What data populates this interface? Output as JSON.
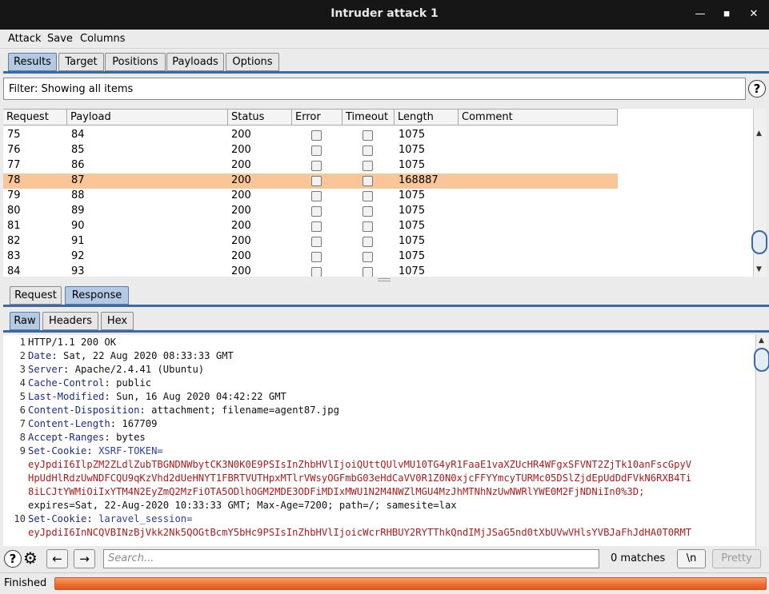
{
  "window": {
    "title": "Intruder attack 1",
    "minimize": "—",
    "maximize": "◼",
    "close": "✕"
  },
  "menu": [
    "Attack",
    "Save",
    "Columns"
  ],
  "main_tabs": [
    {
      "label": "Results",
      "active": true
    },
    {
      "label": "Target",
      "active": false
    },
    {
      "label": "Positions",
      "active": false
    },
    {
      "label": "Payloads",
      "active": false
    },
    {
      "label": "Options",
      "active": false
    }
  ],
  "filter": {
    "text": "Filter: Showing all items",
    "help": "?"
  },
  "table": {
    "columns": [
      "Request",
      "Payload",
      "Status",
      "Error",
      "Timeout",
      "Length",
      "Comment"
    ],
    "rows": [
      {
        "request": "75",
        "payload": "84",
        "status": "200",
        "length": "1075",
        "selected": false
      },
      {
        "request": "76",
        "payload": "85",
        "status": "200",
        "length": "1075",
        "selected": false
      },
      {
        "request": "77",
        "payload": "86",
        "status": "200",
        "length": "1075",
        "selected": false
      },
      {
        "request": "78",
        "payload": "87",
        "status": "200",
        "length": "168887",
        "selected": true
      },
      {
        "request": "79",
        "payload": "88",
        "status": "200",
        "length": "1075",
        "selected": false
      },
      {
        "request": "80",
        "payload": "89",
        "status": "200",
        "length": "1075",
        "selected": false
      },
      {
        "request": "81",
        "payload": "90",
        "status": "200",
        "length": "1075",
        "selected": false
      },
      {
        "request": "82",
        "payload": "91",
        "status": "200",
        "length": "1075",
        "selected": false
      },
      {
        "request": "83",
        "payload": "92",
        "status": "200",
        "length": "1075",
        "selected": false
      },
      {
        "request": "84",
        "payload": "93",
        "status": "200",
        "length": "1075",
        "selected": false
      }
    ]
  },
  "detail_tabs": [
    {
      "label": "Request",
      "active": false
    },
    {
      "label": "Response",
      "active": true
    }
  ],
  "view_tabs": [
    {
      "label": "Raw",
      "active": true
    },
    {
      "label": "Headers",
      "active": false
    },
    {
      "label": "Hex",
      "active": false
    }
  ],
  "response": {
    "lines": [
      {
        "n": "1",
        "key": "",
        "sep": "",
        "value": "HTTP/1.1 200 OK"
      },
      {
        "n": "2",
        "key": "Date",
        "sep": ": ",
        "value": "Sat, 22 Aug 2020 08:33:33 GMT"
      },
      {
        "n": "3",
        "key": "Server",
        "sep": ": ",
        "value": "Apache/2.4.41 (Ubuntu)"
      },
      {
        "n": "4",
        "key": "Cache-Control",
        "sep": ": ",
        "value": "public"
      },
      {
        "n": "5",
        "key": "Last-Modified",
        "sep": ": ",
        "value": "Sun, 16 Aug 2020 04:42:22 GMT"
      },
      {
        "n": "6",
        "key": "Content-Disposition",
        "sep": ": ",
        "value": "attachment; filename=agent87.jpg"
      },
      {
        "n": "7",
        "key": "Content-Length",
        "sep": ": ",
        "value": "167709"
      },
      {
        "n": "8",
        "key": "Accept-Ranges",
        "sep": ": ",
        "value": "bytes"
      }
    ],
    "cookie1": {
      "n": "9",
      "key": "Set-Cookie",
      "name": "XSRF-TOKEN=",
      "value_lines": [
        "eyJpdiI6IlpZM2ZLdlZubTBGNDNWbytCK3N0K0E9PSIsInZhbHVlIjoiQUttQUlvMU10TG4yR1FaaE1vaXZUcHR4WFgxSFVNT2ZjTk10anFscGpyV",
        "HpUdHlRdzUwNDFCQU9qKzVhd2dUeHNYT1FBRTVUTHpxMTlrVWsyOGFmbG03eHdCaVV0R1Z0N0xjcFFYYmcyTURMc05DSlZjdEpUdDdFVkN6RXB4Ti",
        "8iLCJtYWMiOiIxYTM4N2EyZmQ2MzFiOTA5ODlhOGM2MDE3ODFiMDIxMWU1N2M4NWZlMGU4MzJhMTNhNzUwNWRlYWE0M2FjNDNiIn0%3D;"
      ],
      "attrs": "expires=Sat, 22-Aug-2020 10:33:33 GMT; Max-Age=7200; path=/; samesite=lax"
    },
    "cookie2": {
      "n": "10",
      "key": "Set-Cookie",
      "name": "laravel_session=",
      "value_lines": [
        "eyJpdiI6InNCQVBINzBjVkk2Nk5QOGtBcmY5bHc9PSIsInZhbHVlIjoicWcrRHBUY2RYTThkQndIMjJSaG5nd0tXbUVwVHlsYVBJaFhJdHA0T0RMT"
      ]
    }
  },
  "bottom": {
    "help": "?",
    "settings": "⚙",
    "back": "←",
    "forward": "→",
    "search_placeholder": "Search...",
    "matches": "0 matches",
    "newline": "\\n",
    "pretty": "Pretty"
  },
  "status": {
    "text": "Finished",
    "progress": 1.0
  }
}
